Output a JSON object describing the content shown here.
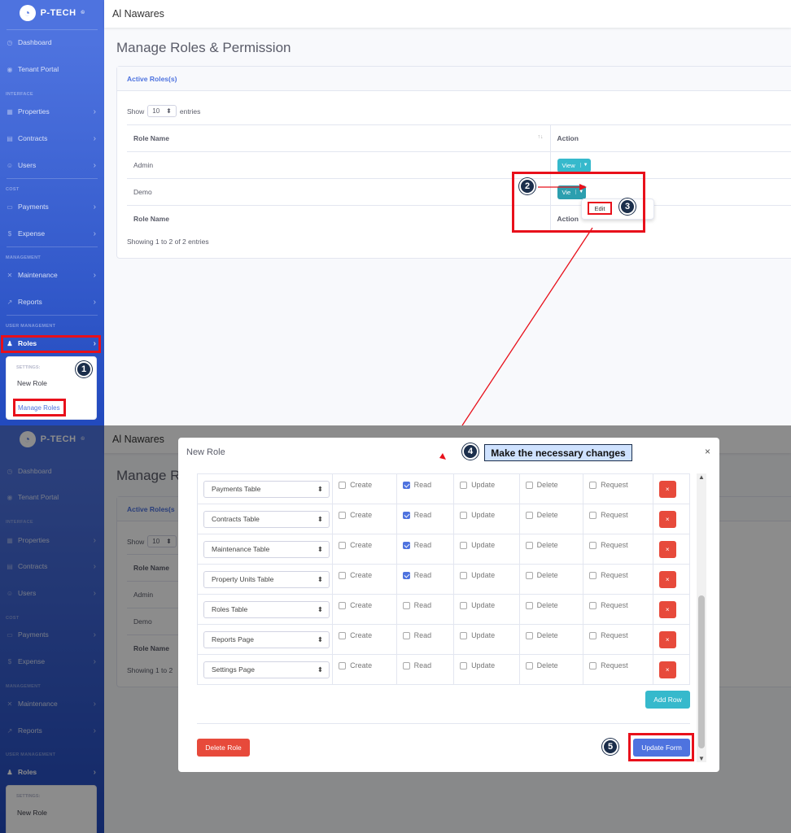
{
  "app": {
    "brand": "P-TECH",
    "brand_mark": "©",
    "tenant_name": "Al Nawares",
    "page_title_full": "Manage Roles & Permission",
    "page_title_partial": "Manage Ro"
  },
  "sidebar": {
    "items": [
      {
        "label": "Dashboard",
        "icon": "dashboard-icon"
      },
      {
        "label": "Tenant Portal",
        "icon": "portal-icon"
      },
      {
        "label": "Properties",
        "icon": "building-icon"
      },
      {
        "label": "Contracts",
        "icon": "file-icon"
      },
      {
        "label": "Users",
        "icon": "users-icon"
      },
      {
        "label": "Payments",
        "icon": "money-icon"
      },
      {
        "label": "Expense",
        "icon": "dollar-icon"
      },
      {
        "label": "Maintenance",
        "icon": "tools-icon"
      },
      {
        "label": "Reports",
        "icon": "chart-icon"
      },
      {
        "label": "Roles",
        "icon": "user-tag-icon"
      }
    ],
    "sections": {
      "interface": "INTERFACE",
      "cost": "COST",
      "management": "MANAGEMENT",
      "user_management": "USER MANAGEMENT"
    },
    "roles_submenu": {
      "heading": "SETTINGS:",
      "items": [
        "New Role",
        "Manage Roles"
      ]
    }
  },
  "roles_card": {
    "header": "Active Roles(s)",
    "header_partial": "Active Roles(s",
    "show_label": "Show",
    "entries_value": "10",
    "entries_label": "entries",
    "columns": [
      "Role Name",
      "Action"
    ],
    "sort_icon": "↑↓",
    "rows": [
      {
        "role": "Admin",
        "action": "View"
      },
      {
        "role": "Demo",
        "action": "View"
      }
    ],
    "footer_cols": [
      "Role Name",
      "Action"
    ],
    "info": "Showing 1 to 2 of 2 entries",
    "info_partial": "Showing 1 to 2",
    "dropdown_item": "Edit",
    "partial_view": "Vie"
  },
  "steps": {
    "s1": "1",
    "s2": "2",
    "s3": "3",
    "s4": "4",
    "s5": "5",
    "callout": "Make the necessary changes"
  },
  "modal": {
    "title": "New Role",
    "close": "×",
    "permissions_labels": [
      "Create",
      "Read",
      "Update",
      "Delete",
      "Request"
    ],
    "rows": [
      {
        "resource": "Payments Table",
        "checked": [
          false,
          true,
          false,
          false,
          false
        ]
      },
      {
        "resource": "Contracts Table",
        "checked": [
          false,
          true,
          false,
          false,
          false
        ]
      },
      {
        "resource": "Maintenance Table",
        "checked": [
          false,
          true,
          false,
          false,
          false
        ]
      },
      {
        "resource": "Property Units Table",
        "checked": [
          false,
          true,
          false,
          false,
          false
        ]
      },
      {
        "resource": "Roles Table",
        "checked": [
          false,
          false,
          false,
          false,
          false
        ]
      },
      {
        "resource": "Reports Page",
        "checked": [
          false,
          false,
          false,
          false,
          false
        ]
      },
      {
        "resource": "Settings Page",
        "checked": [
          false,
          false,
          false,
          false,
          false
        ]
      }
    ],
    "remove_label": "×",
    "add_row": "Add Row",
    "delete_role": "Delete Role",
    "update_form": "Update Form"
  },
  "colors": {
    "sidebar": "#4e73df",
    "info_button": "#36b9cc",
    "danger": "#e74a3b",
    "primary": "#4e73df",
    "highlight": "#e8101b",
    "badge": "#1b2e4b",
    "callout_bg": "#cfe2ff"
  }
}
